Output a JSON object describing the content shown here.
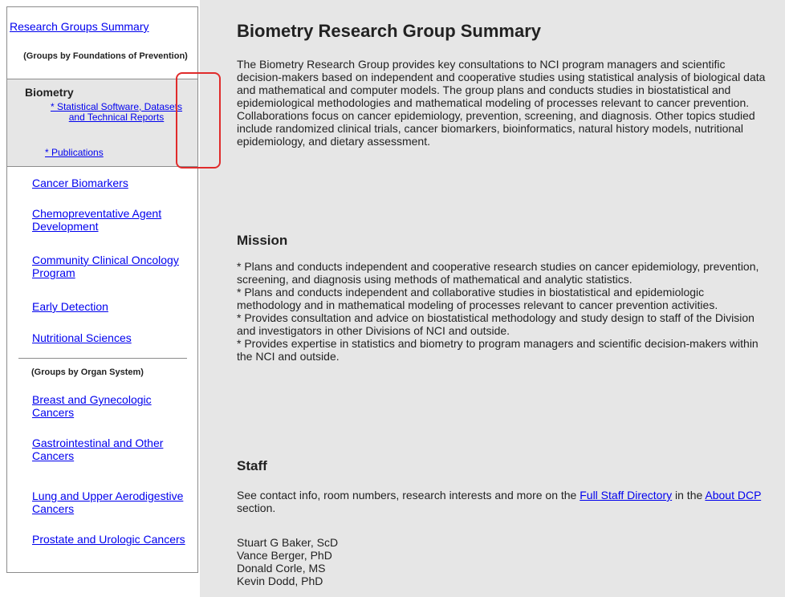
{
  "sidebar": {
    "top_link": "Research Groups Summary",
    "group_heading_1": "(Groups by Foundations of Prevention)",
    "biometry": {
      "title": "Biometry",
      "software_link": "* Statistical Software, Datasets and Technical Reports",
      "publications_link": "* Publications"
    },
    "foundation_links": [
      "Cancer Biomarkers",
      "Chemopreventative Agent Development",
      "Community Clinical Oncology Program",
      "Early Detection",
      "Nutritional Sciences"
    ],
    "group_heading_2": "(Groups by Organ System)",
    "organ_links": [
      "Breast and Gynecologic Cancers",
      "Gastrointestinal and Other Cancers",
      "Lung and Upper Aerodigestive Cancers",
      "Prostate and Urologic Cancers"
    ]
  },
  "main": {
    "title": "Biometry Research Group Summary",
    "intro": "The Biometry Research Group provides key consultations to NCI program managers and scientific decision-makers based on independent and cooperative studies using statistical analysis of biological data and mathematical and computer models. The group plans and conducts studies in biostatistical and epidemiological methodologies and mathematical modeling of processes relevant to cancer prevention. Collaborations focus on cancer epidemiology, prevention, screening, and diagnosis. Other topics studied include randomized clinical trials, cancer biomarkers, bioinformatics, natural history models, nutritional epidemiology, and dietary assessment.",
    "mission_heading": "Mission",
    "mission_items": [
      "* Plans and conducts independent and cooperative research studies on cancer epidemiology, prevention, screening, and diagnosis using methods of mathematical and analytic statistics.",
      "* Plans and conducts independent and collaborative studies in biostatistical and epidemiologic methodology and in mathematical modeling of processes relevant to cancer prevention activities.",
      "* Provides consultation and advice on biostatistical methodology and study design to staff of the Division and investigators in other Divisions of NCI and outside.",
      "* Provides expertise in statistics and biometry to program managers and scientific decision-makers within the NCI and outside."
    ],
    "staff_heading": "Staff",
    "staff_intro": {
      "prefix": "See contact info, room numbers, research interests and more on the",
      "link1": "Full Staff Directory",
      "middle": "in the",
      "link2": "About DCP",
      "suffix": "section."
    },
    "staff_list": [
      "Stuart G Baker, ScD",
      "Vance Berger, PhD",
      "Donald Corle, MS",
      "Kevin Dodd, PhD"
    ]
  },
  "colors": {
    "link": "#0000ee",
    "main_background": "#e6e6e6",
    "highlight": "#e02b2b"
  }
}
